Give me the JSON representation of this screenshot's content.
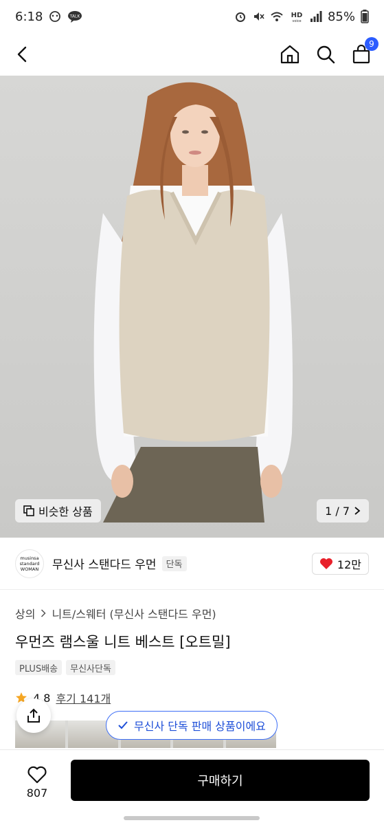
{
  "status_bar": {
    "time": "6:18",
    "battery": "85%",
    "icons": [
      "cloud-face-icon",
      "talk-icon",
      "alarm-icon",
      "mute-icon",
      "wifi-icon",
      "hd-voice-icon",
      "signal-icon",
      "battery-icon"
    ]
  },
  "nav": {
    "back_icon": "chevron-left-icon",
    "home_icon": "home-icon",
    "search_icon": "search-icon",
    "cart_icon": "shopping-bag-icon",
    "cart_count": "9",
    "badge_color": "#2b5cff"
  },
  "hero": {
    "similar_label": "비슷한 상품",
    "page_counter": "1 / 7"
  },
  "brand": {
    "logo_line1": "musinsa",
    "logo_line2": "standard",
    "logo_line3": "WOMAN",
    "name": "무신사 스탠다드 우먼",
    "tag": "단독",
    "likes": "12만",
    "heart_color": "#e8202a"
  },
  "product": {
    "breadcrumb_1": "상의",
    "breadcrumb_2": "니트/스웨터 (무신사 스탠다드 우먼)",
    "title": "우먼즈 램스울 니트 베스트 [오트밀]",
    "tags": [
      "PLUS배송",
      "무신사단독"
    ],
    "rating": "4.8",
    "review_link": "후기 141개",
    "star_color": "#f5a623"
  },
  "toast": {
    "message": "무신사 단독 판매 상품이에요",
    "color": "#1d4ed8"
  },
  "bottom": {
    "wish_count": "807",
    "buy_label": "구매하기"
  }
}
